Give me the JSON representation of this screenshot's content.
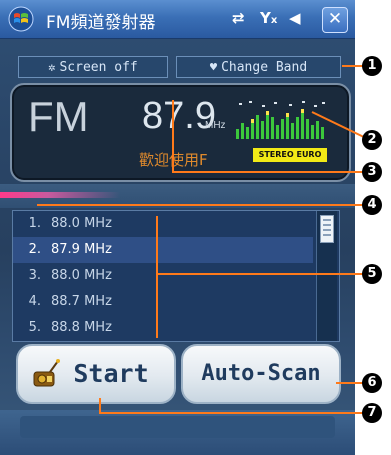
{
  "titlebar": {
    "title": "FM頻道發射器",
    "close_label": "✕"
  },
  "top_buttons": {
    "screen_off": "Screen off",
    "change_band": "Change Band"
  },
  "display": {
    "band": "FM",
    "frequency": "87.9",
    "unit": "MHz",
    "station_text": "歡迎使用F",
    "badge": "STEREO EURO"
  },
  "stations": [
    {
      "num": "1.",
      "freq": "88.0 MHz",
      "selected": false
    },
    {
      "num": "2.",
      "freq": "87.9 MHz",
      "selected": true
    },
    {
      "num": "3.",
      "freq": "88.0 MHz",
      "selected": false
    },
    {
      "num": "4.",
      "freq": "88.7 MHz",
      "selected": false
    },
    {
      "num": "5.",
      "freq": "88.8 MHz",
      "selected": false
    }
  ],
  "buttons": {
    "start": "Start",
    "auto_scan": "Auto-Scan"
  },
  "markers": [
    "1",
    "2",
    "3",
    "4",
    "5",
    "6",
    "7"
  ],
  "colors": {
    "accent_orange": "#e08a2c",
    "badge_yellow": "#f2ea16",
    "title_blue": "#3a6fb6"
  }
}
